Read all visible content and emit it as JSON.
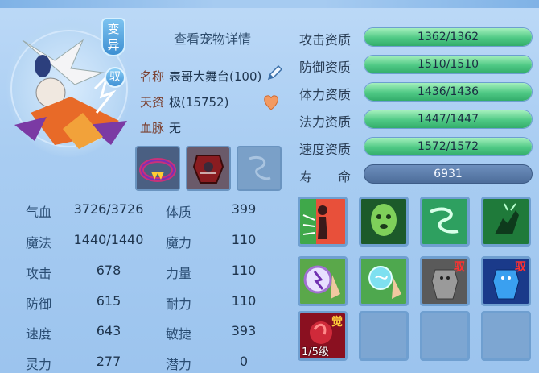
{
  "top": {
    "left_title_fragment": "(…)",
    "right_title_fragment": ""
  },
  "portrait": {
    "badge_bian": "变异",
    "badge_yu": "驭"
  },
  "info": {
    "detail_link": "查看宠物详情",
    "name_label": "名称",
    "name_value": "表哥大舞台(100)",
    "talent_label": "天资",
    "talent_value": "极(15752)",
    "bloodline_label": "血脉",
    "bloodline_value": "无"
  },
  "attributes": {
    "left": [
      {
        "label": "气血",
        "value": "3726/3726"
      },
      {
        "label": "魔法",
        "value": "1440/1440"
      },
      {
        "label": "攻击",
        "value": "678"
      },
      {
        "label": "防御",
        "value": "615"
      },
      {
        "label": "速度",
        "value": "643"
      },
      {
        "label": "灵力",
        "value": "277"
      }
    ],
    "right": [
      {
        "label": "体质",
        "value": "399"
      },
      {
        "label": "魔力",
        "value": "110"
      },
      {
        "label": "力量",
        "value": "110"
      },
      {
        "label": "耐力",
        "value": "110"
      },
      {
        "label": "敏捷",
        "value": "393"
      },
      {
        "label": "潜力",
        "value": "0"
      }
    ]
  },
  "aptitudes": [
    {
      "label": "攻击资质",
      "value": "1362/1362",
      "fill": 1.0
    },
    {
      "label": "防御资质",
      "value": "1510/1510",
      "fill": 1.0
    },
    {
      "label": "体力资质",
      "value": "1436/1436",
      "fill": 1.0
    },
    {
      "label": "法力资质",
      "value": "1447/1447",
      "fill": 1.0
    },
    {
      "label": "速度资质",
      "value": "1572/1572",
      "fill": 1.0
    }
  ],
  "lifespan": {
    "label": "寿　　命",
    "value": "6931"
  },
  "skills": {
    "yu_tag": "驭",
    "jue_tag": "觉",
    "awaken_level": "1/5级"
  },
  "colors": {
    "bar_green": "#4fc985",
    "bar_blue": "#5577a6",
    "accent_red": "#ff3030"
  }
}
